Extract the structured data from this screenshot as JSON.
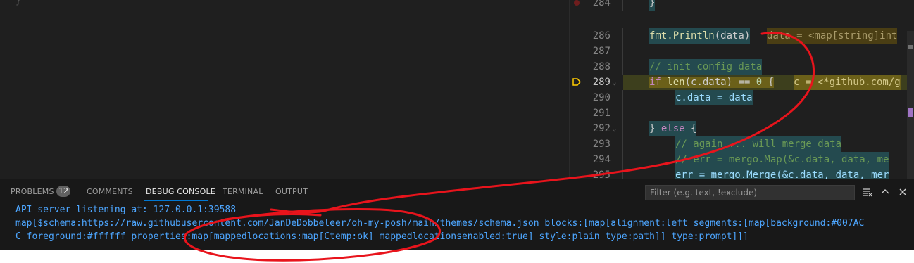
{
  "left_pane": {
    "ghost_text": "}"
  },
  "editor": {
    "line_numbers": [
      "284",
      "286",
      "287",
      "288",
      "289",
      "290",
      "291",
      "292",
      "293",
      "294",
      "295"
    ],
    "lines": {
      "l284": "}",
      "l286_stmt_func": "fmt.Println",
      "l286_stmt_args": "(data)",
      "l286_inline": "data = <map[string]int",
      "l288_comment": "// init config data",
      "l289_kw": "if",
      "l289_fn": "len",
      "l289_rest": "(c.data) == ",
      "l289_num": "0",
      "l289_brace": " {",
      "l289_inline": "c = <*github.com/g",
      "l290": "c.data = data",
      "l292_close": "} ",
      "l292_kw": "else",
      "l292_brace": " {",
      "l293": "// again ... will merge data",
      "l294": "// err = mergo.Map(&c.data, data, me",
      "l295": "err = mergo.Merge(&c.data, data, mer"
    }
  },
  "panel": {
    "tabs": [
      {
        "label": "PROBLEMS"
      },
      {
        "label": "COMMENTS"
      },
      {
        "label": "DEBUG CONSOLE"
      },
      {
        "label": "TERMINAL"
      },
      {
        "label": "OUTPUT"
      }
    ],
    "problems_count": "12",
    "active_tab": "DEBUG CONSOLE",
    "filter_placeholder": "Filter (e.g. text, !exclude)",
    "console_lines": [
      "API server listening at: 127.0.0.1:39588",
      "map[$schema:https://raw.githubusercontent.com/JanDeDobbeleer/oh-my-posh/main/themes/schema.json blocks:[map[alignment:left segments:[map[background:#007AC",
      "C foreground:#ffffff properties:map[mappedlocations:map[Ctemp:ok] mappedlocationsenabled:true] style:plain type:path]] type:prompt]]]"
    ]
  },
  "icons": [
    "breakpoint-icon",
    "debug-current-line-icon",
    "fold-chevron-icon",
    "clear-console-icon",
    "collapse-panel-icon",
    "close-panel-icon"
  ],
  "colors": {
    "editor_bg": "#1f1f1f",
    "panel_bg": "#181818",
    "console_text": "#4da6ff",
    "active_tab_underline": "#0078d4",
    "annotation_red": "#e8141c"
  }
}
